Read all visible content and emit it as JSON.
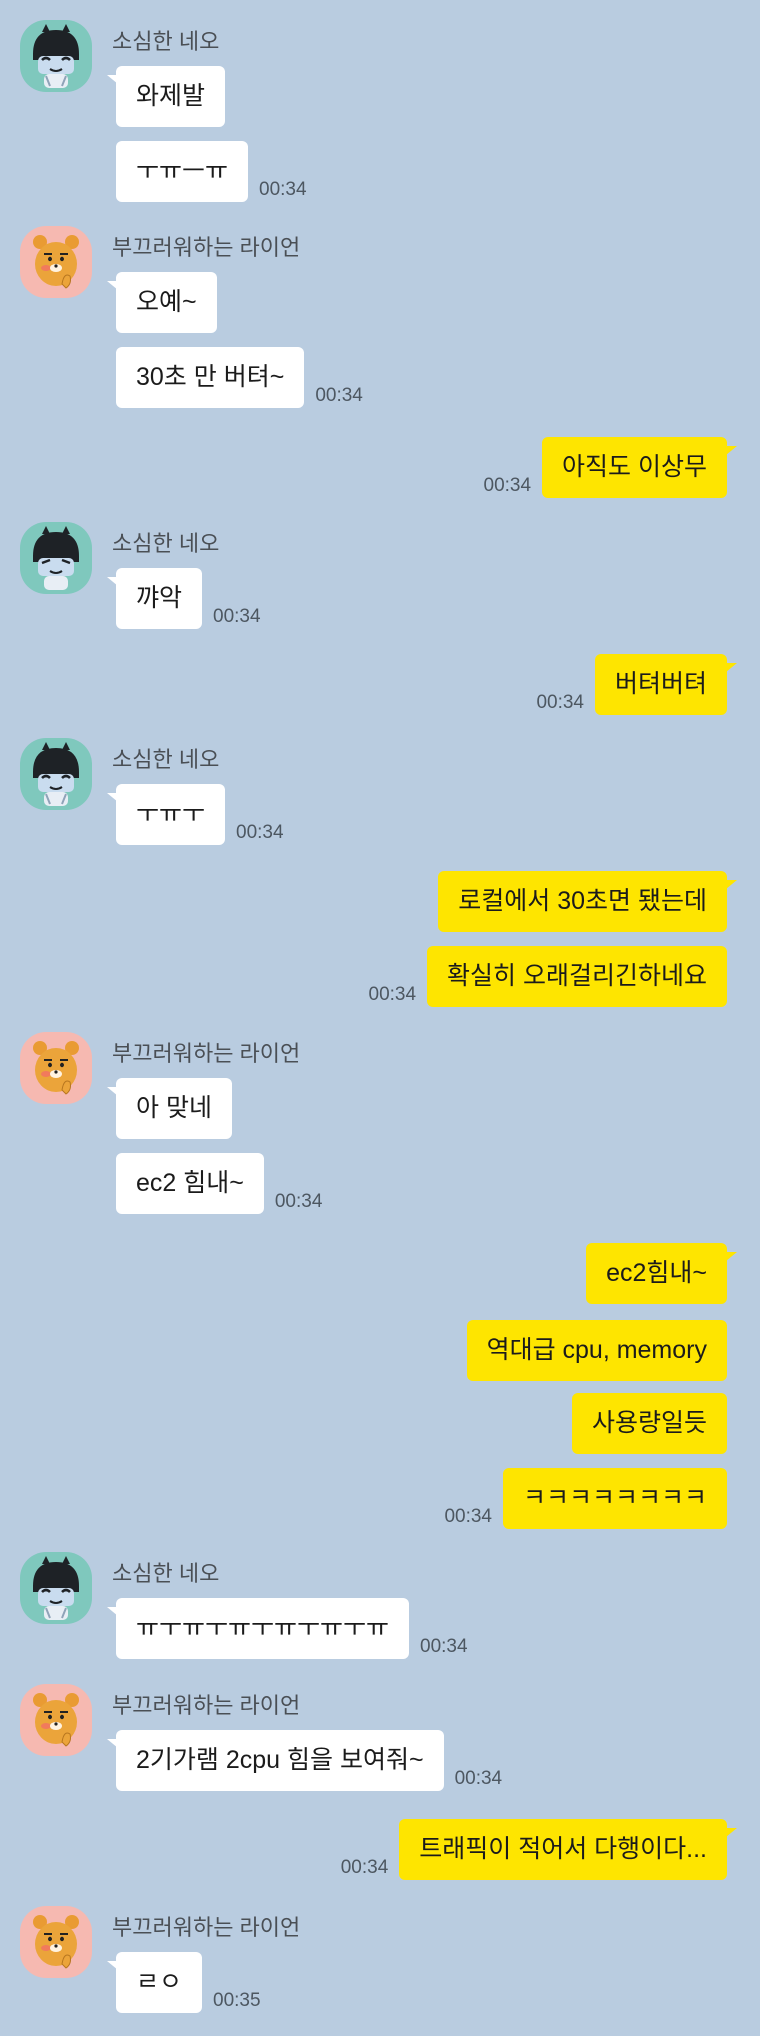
{
  "senders": {
    "neo": "소심한 네오",
    "ryan": "부끄러워하는 라이언"
  },
  "messages": [
    {
      "id": "m1",
      "from": "neo",
      "text": "와제발",
      "time": ""
    },
    {
      "id": "m2",
      "from": "neo",
      "text": "ㅜㅠㅡㅠ",
      "time": "00:34"
    },
    {
      "id": "m3",
      "from": "ryan",
      "text": "오예~",
      "time": ""
    },
    {
      "id": "m4",
      "from": "ryan",
      "text": "30초 만 버텨~",
      "time": "00:34"
    },
    {
      "id": "m5",
      "from": "me",
      "text": "아직도 이상무",
      "time": "00:34"
    },
    {
      "id": "m6",
      "from": "neo",
      "text": "꺄악",
      "time": "00:34"
    },
    {
      "id": "m7",
      "from": "me",
      "text": "버텨버텨",
      "time": "00:34"
    },
    {
      "id": "m8",
      "from": "neo",
      "text": "ㅜㅠㅜ",
      "time": "00:34"
    },
    {
      "id": "m9",
      "from": "me",
      "text": "로컬에서 30초면 됐는데",
      "time": ""
    },
    {
      "id": "m10",
      "from": "me",
      "text": "확실히 오래걸리긴하네요",
      "time": "00:34"
    },
    {
      "id": "m11",
      "from": "ryan",
      "text": "아 맞네",
      "time": ""
    },
    {
      "id": "m12",
      "from": "ryan",
      "text": "ec2 힘내~",
      "time": "00:34"
    },
    {
      "id": "m13",
      "from": "me",
      "text": "ec2힘내~",
      "time": ""
    },
    {
      "id": "m14",
      "from": "me",
      "text": "역대급 cpu, memory",
      "time": ""
    },
    {
      "id": "m15",
      "from": "me",
      "text": "사용량일듯",
      "time": ""
    },
    {
      "id": "m16",
      "from": "me",
      "text": "ㅋㅋㅋㅋㅋㅋㅋㅋ",
      "time": "00:34"
    },
    {
      "id": "m17",
      "from": "neo",
      "text": "ㅠㅜㅠㅜㅠㅜㅠㅜㅠㅜㅠ",
      "time": "00:34"
    },
    {
      "id": "m18",
      "from": "ryan",
      "text": "2기가램 2cpu 힘을 보여줘~",
      "time": "00:34"
    },
    {
      "id": "m19",
      "from": "me",
      "text": "트래픽이 적어서 다행이다...",
      "time": "00:34"
    },
    {
      "id": "m20",
      "from": "ryan",
      "text": "ㄹㅇ",
      "time": "00:35"
    }
  ],
  "colors": {
    "background": "#b9cce0",
    "my_bubble": "#fee500",
    "their_bubble": "#ffffff",
    "neo_avatar_bg": "#7fc8bd",
    "ryan_avatar_bg": "#f6b9b1"
  }
}
